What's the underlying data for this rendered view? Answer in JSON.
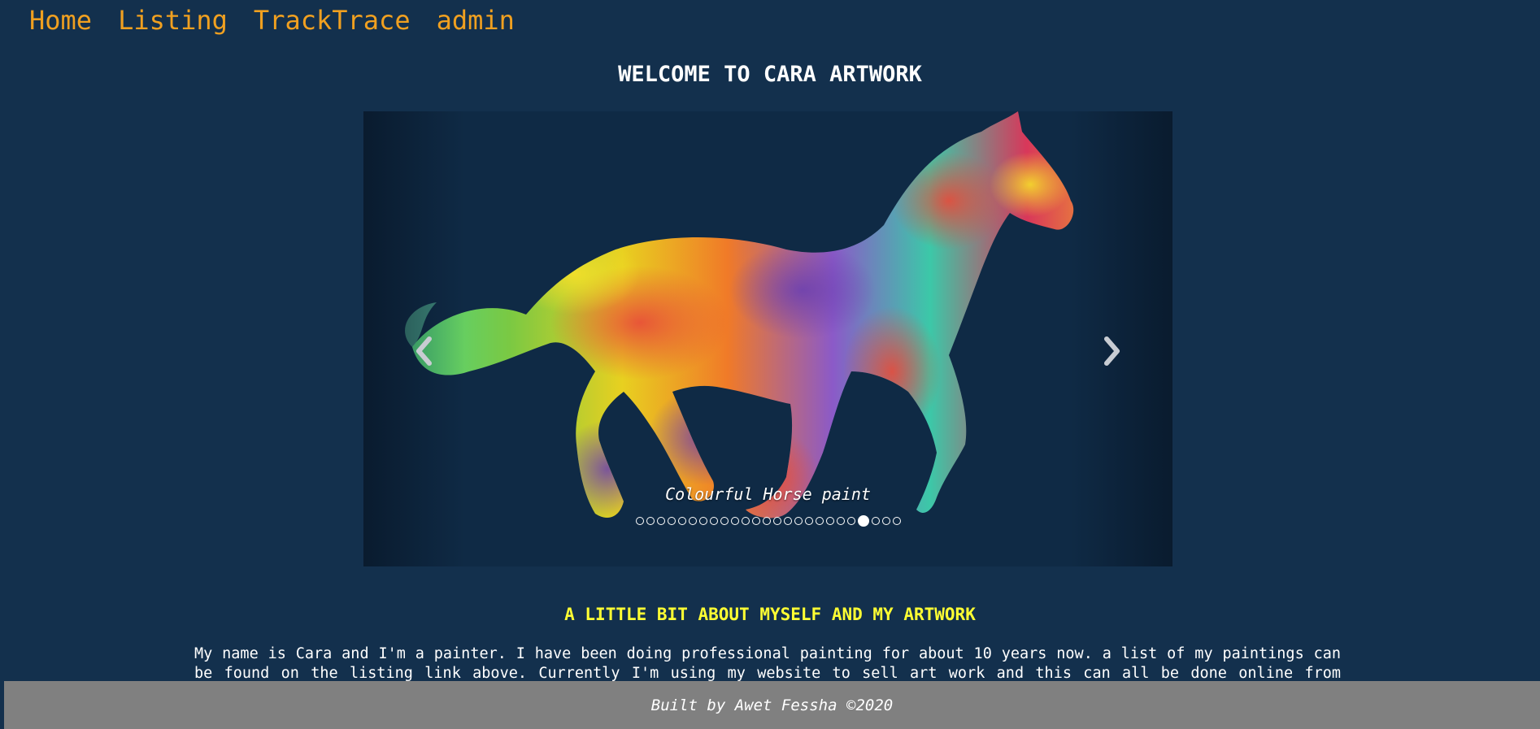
{
  "nav": {
    "items": [
      {
        "label": "Home"
      },
      {
        "label": "Listing"
      },
      {
        "label": "TrackTrace"
      },
      {
        "label": "admin"
      }
    ]
  },
  "header": {
    "title": "WELCOME TO CARA ARTWORK"
  },
  "carousel": {
    "caption": "Colourful Horse paint",
    "image": "colourful-horse-painting",
    "prev_icon": "chevron-left-icon",
    "next_icon": "chevron-right-icon",
    "indicator_count": 25,
    "active_indicator": 21
  },
  "about": {
    "heading": "A LITTLE BIT ABOUT MYSELF AND MY ARTWORK",
    "text": "My name is Cara and I'm a painter. I have been doing professional painting for about 10 years now. a list of my paintings can be found on the listing link above. Currently I'm using my website to sell art work and this can all be done online from ordering"
  },
  "footer": {
    "text": "Built by Awet Fessha ©2020"
  },
  "colors": {
    "background": "#13304d",
    "nav_link": "#f0a020",
    "about_heading": "#ffff33",
    "footer_bg": "#808080"
  }
}
